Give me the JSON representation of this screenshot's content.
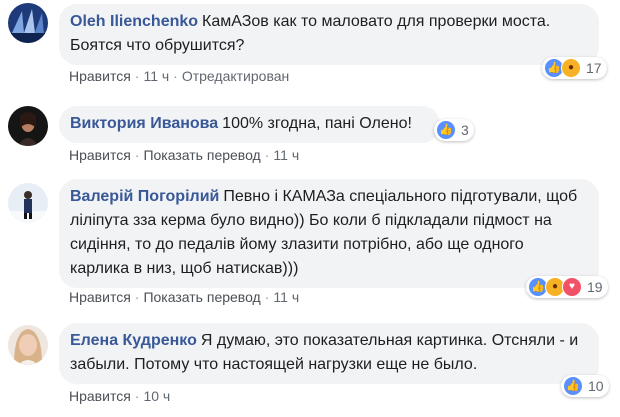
{
  "comments": [
    {
      "author": "Oleh Ilienchenko",
      "text": "КамАЗов как то маловато для проверки моста. Боятся что обрушится?",
      "actions": [
        "Нравится",
        "11 ч",
        "Отредактирован"
      ],
      "reaction_count": "17"
    },
    {
      "author": "Виктория Иванова",
      "text": "100% згодна, пані Олено!",
      "actions": [
        "Нравится",
        "Показать перевод",
        "11 ч"
      ],
      "reaction_count": "3"
    },
    {
      "author": "Валерій Погорілий",
      "text": "Певно і КАМАЗа спеціального підготували, щоб ліліпута зза керма було видно)) Бо коли б підкладали підмост на сидіння, то до педалів йому злазити потрібно, або ще одного карлика в низ, щоб натискав)))",
      "actions": [
        "Нравится",
        "Показать перевод",
        "11 ч"
      ],
      "reaction_count": "19"
    },
    {
      "author": "Елена Кудренко",
      "text": "Я думаю, это показательная картинка. Отсняли - и забыли. Потому что настоящей нагрузки еще не было.",
      "actions": [
        "Нравится",
        "10 ч"
      ],
      "reaction_count": "10"
    }
  ],
  "icons": {
    "like": "like-icon",
    "angry": "angry-icon",
    "haha": "haha-icon",
    "love": "love-icon"
  },
  "colors": {
    "author": "#385898",
    "bubble": "#f2f3f5",
    "like": "#5890ff"
  }
}
